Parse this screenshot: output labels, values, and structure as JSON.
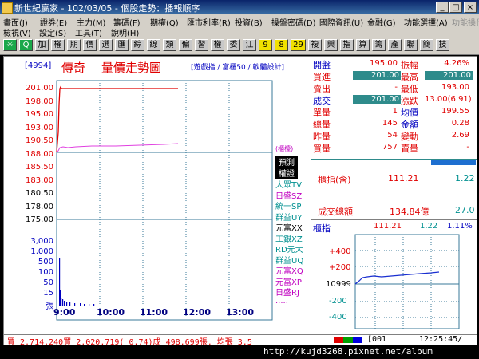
{
  "window": {
    "title": "新世紀贏家 - 102/03/05 - 個股走勢：播報順序",
    "buttons": [
      "_",
      "□",
      "×"
    ]
  },
  "menu": {
    "row1": [
      {
        "label": "畫面(J)",
        "disabled": false
      },
      {
        "label": "證券(E)",
        "disabled": false
      },
      {
        "label": "主力(M)",
        "disabled": false
      },
      {
        "label": "籌碼(F)",
        "disabled": false
      },
      {
        "label": "期權(Q)",
        "disabled": false
      },
      {
        "label": "匯市利率(R)",
        "disabled": false
      },
      {
        "label": "投資(B)",
        "disabled": false
      },
      {
        "label": "操盤密碼(D)",
        "disabled": false
      },
      {
        "label": "國際資訊(U)",
        "disabled": false
      },
      {
        "label": "金融(G)",
        "disabled": false
      },
      {
        "label": "功能選擇(A)",
        "disabled": false
      },
      {
        "label": "功能操作(P)",
        "disabled": true
      }
    ],
    "row2": [
      {
        "label": "檢視(V)",
        "disabled": false
      },
      {
        "label": "設定(S)",
        "disabled": false
      },
      {
        "label": "工具(T)",
        "disabled": false
      },
      {
        "label": "說明(H)",
        "disabled": false
      }
    ]
  },
  "toolbar": {
    "buttons": [
      "☼",
      "Q",
      "加",
      "權",
      "期",
      "價",
      "選",
      "匯",
      "綜",
      "線",
      "類",
      "偏",
      "習",
      "權",
      "委",
      "江",
      "9",
      "8",
      "29",
      "複",
      "興",
      "指",
      "算",
      "籌",
      "產",
      "聯",
      "簡",
      "技"
    ]
  },
  "stock": {
    "code": "[4994]",
    "name": "傳奇",
    "chart_title": "量價走勢圖",
    "note": "[遊戲指 / 富櫃50 / 軟體設計]"
  },
  "quote": {
    "rows": [
      {
        "l1": "開盤",
        "v1": "195.00",
        "l2": "振幅",
        "v2": "4.26%"
      },
      {
        "l1": "買進",
        "v1": "201.00",
        "l2": "最高",
        "v2": "201.00"
      },
      {
        "l1": "賣出",
        "v1": "-",
        "l2": "最低",
        "v2": "193.00"
      },
      {
        "l1": "成交",
        "v1": "201.00",
        "l2": "漲跌",
        "v2": "13.00(6.91)"
      },
      {
        "l1": "單量",
        "v1": "1",
        "l2": "均價",
        "v2": "199.55"
      },
      {
        "l1": "總量",
        "v1": "145",
        "l2": "金額",
        "v2": "0.28"
      },
      {
        "l1": "昨量",
        "v1": "54",
        "l2": "變動",
        "v2": "2.69"
      },
      {
        "l1": "買量",
        "v1": "757",
        "l2": "賣量",
        "v2": "-"
      }
    ]
  },
  "index_panel": {
    "label": "櫃指(含)",
    "value": "111.21",
    "change": "1.22",
    "turnover_label": "成交總額",
    "turnover": "134.84億",
    "turnover2": "27.0"
  },
  "side_list": {
    "tags": [
      "(櫃檯)",
      "預測",
      "權證"
    ],
    "items": [
      "大眾TV",
      "日盛SZ",
      "統一SP",
      "群益UY",
      "元富XX",
      "工銀XZ",
      "RD元大",
      "群益UQ",
      "元富XQ",
      "元富XP",
      "日盛RJ",
      "....."
    ]
  },
  "mini_chart": {
    "title": "櫃指",
    "v1": "111.21",
    "v2": "1.22",
    "pct": "1.11%",
    "base": "10999",
    "yticks": [
      "+400",
      "+200",
      "-200",
      "-400"
    ]
  },
  "status": {
    "text": "買 2,714,240買 2,020,719( 0.74)成 498,699張, 均張 3.5",
    "num": "[001",
    "time": "12:25:45/"
  },
  "url": "http://kujd3268.pixnet.net/album",
  "chart_data": {
    "type": "line",
    "price_ticks": [
      "201.00",
      "198.00",
      "195.00",
      "193.00",
      "190.50",
      "188.00",
      "185.50",
      "183.00",
      "180.50",
      "178.00",
      "175.00"
    ],
    "volume_ticks": [
      "3,000",
      "1,000",
      "500",
      "100",
      "50",
      "15",
      "張"
    ],
    "x": [
      "9:00",
      "10:00",
      "11:00",
      "12:00",
      "13:00"
    ],
    "price_series": {
      "name": "",
      "color": "#e00000"
    },
    "avg_series": {
      "name": "",
      "color": "#e040e0"
    },
    "prev_close": 188.0
  },
  "colors": {
    "up": "#e00000",
    "avg": "#e040e0",
    "title_bg": "#0a246a",
    "panel_bg": "#2e8b8b"
  }
}
